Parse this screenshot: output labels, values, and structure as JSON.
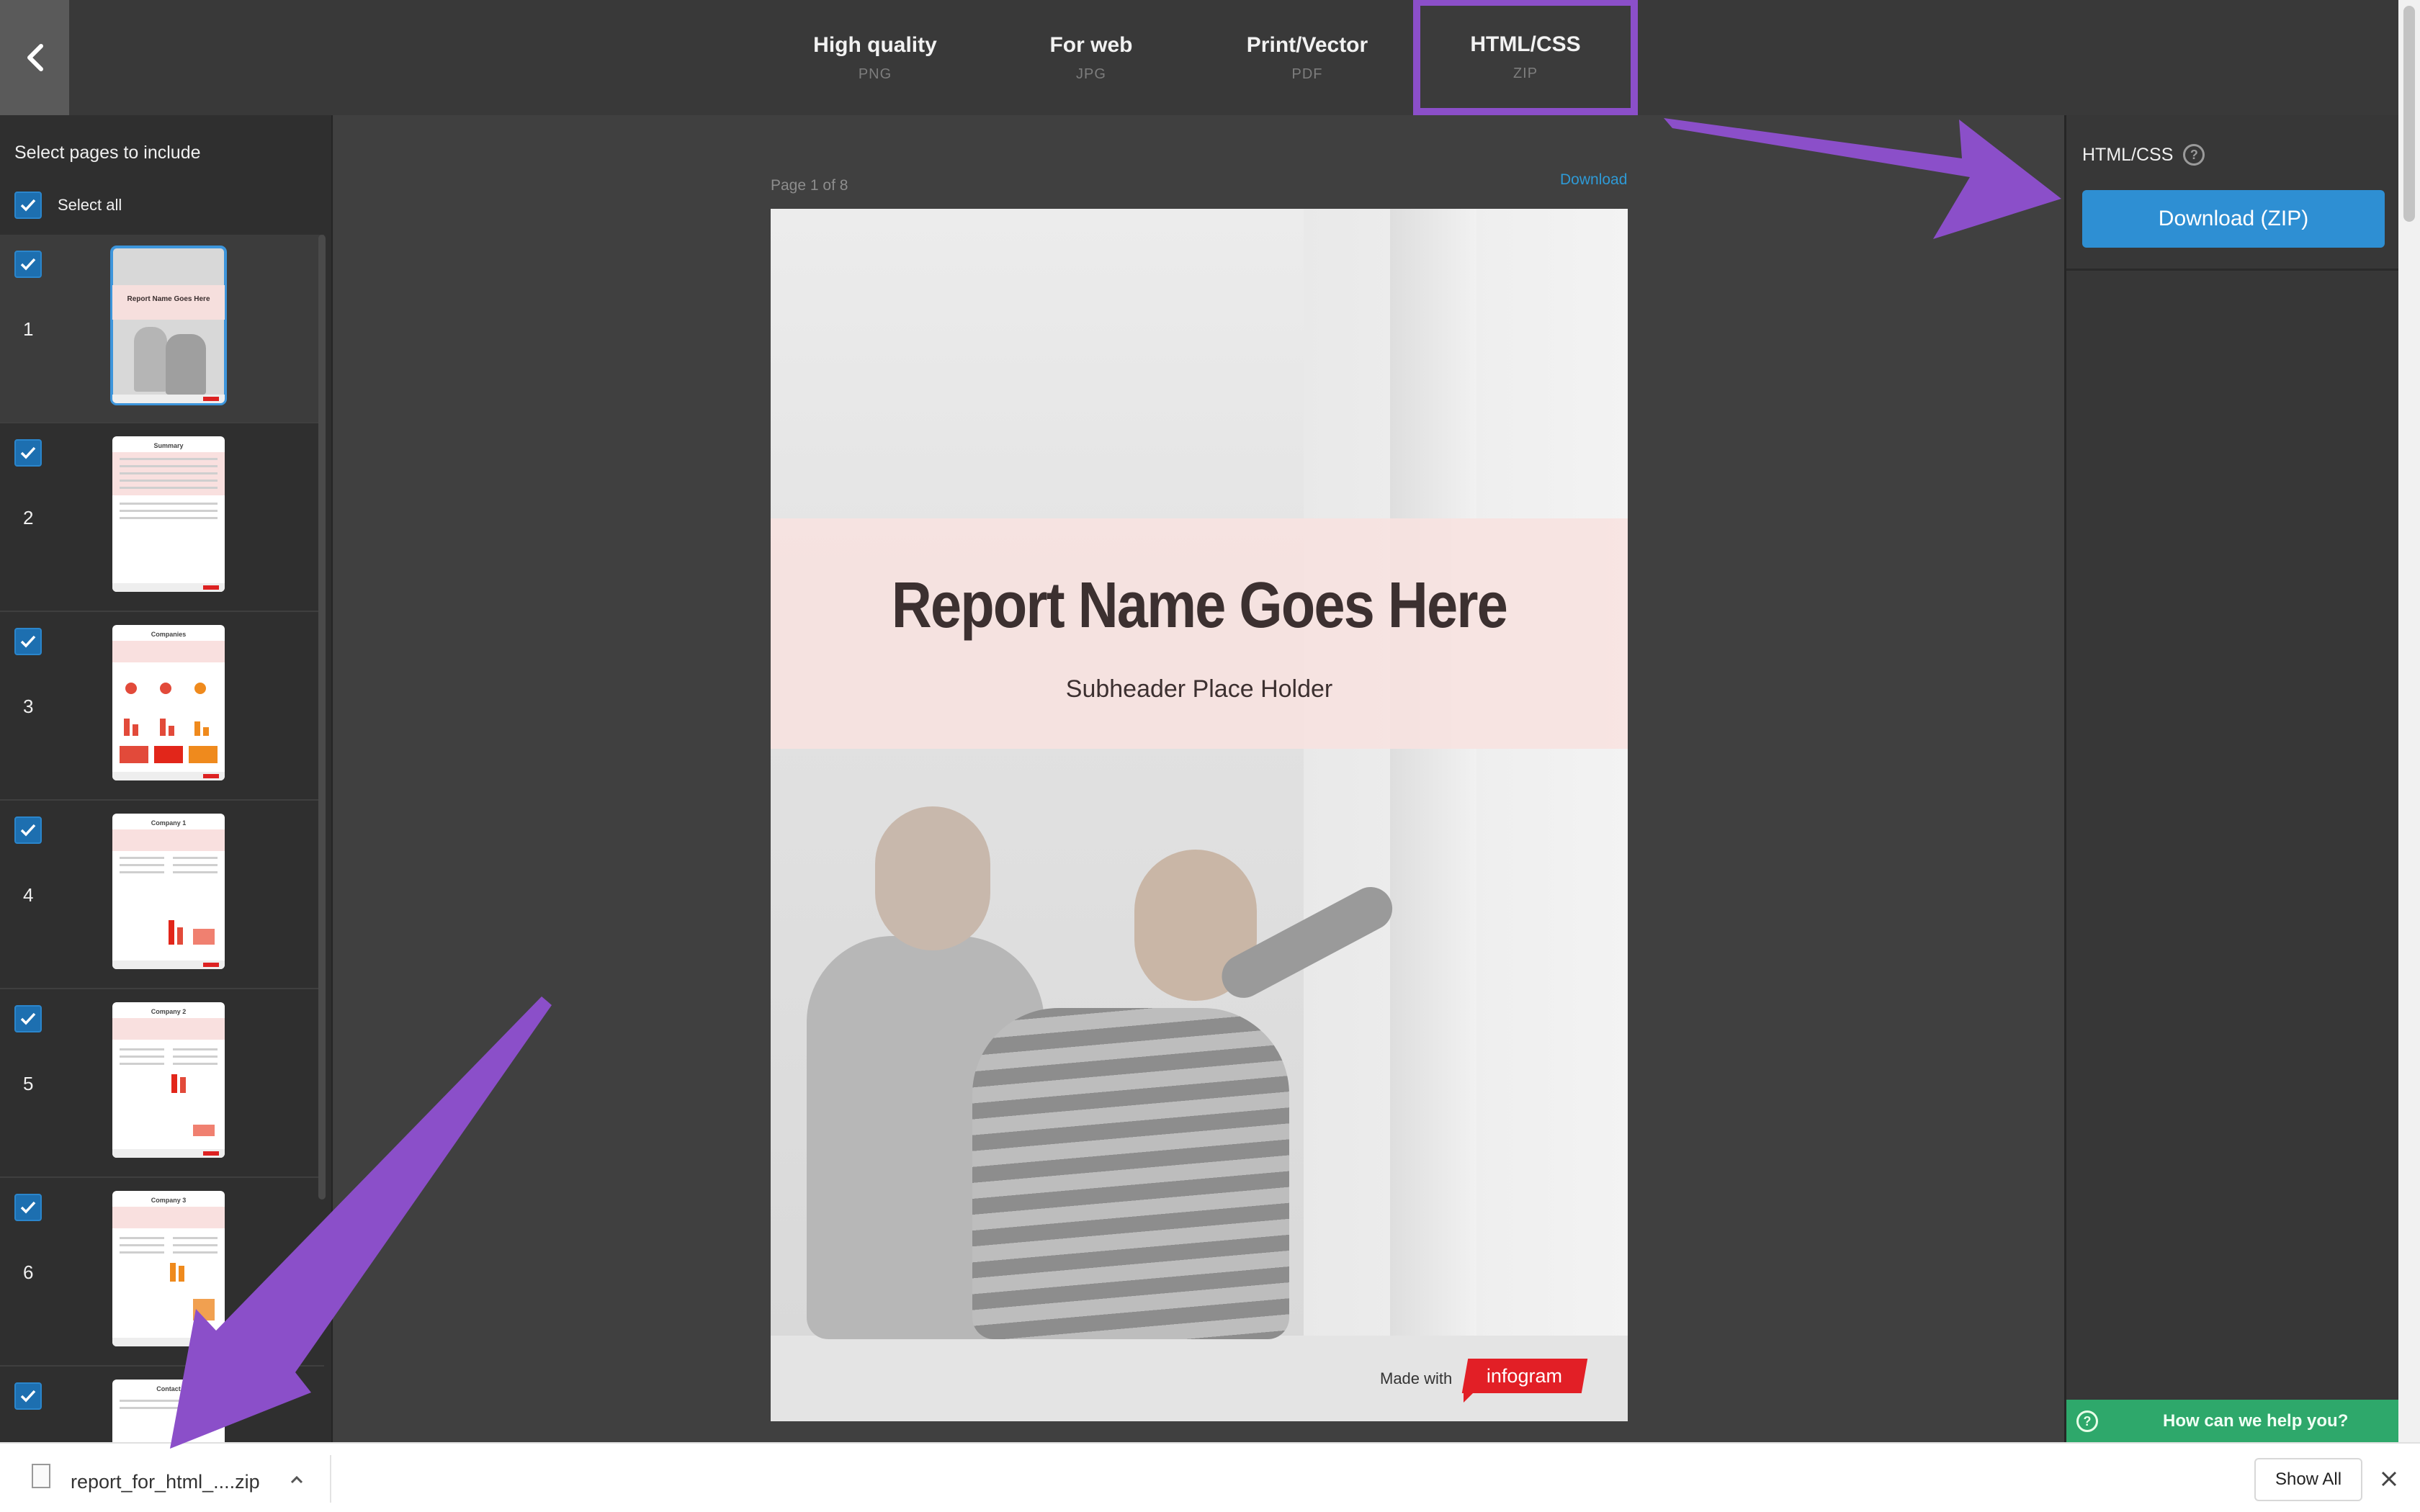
{
  "topbar": {
    "tabs": [
      {
        "label": "High quality",
        "sub": "PNG"
      },
      {
        "label": "For web",
        "sub": "JPG"
      },
      {
        "label": "Print/Vector",
        "sub": "PDF"
      },
      {
        "label": "HTML/CSS",
        "sub": "ZIP"
      }
    ],
    "active_tab": "HTML/CSS",
    "active_color": "#8b4fc9"
  },
  "sidebar": {
    "title": "Select pages to include",
    "select_all": "Select all",
    "pages": [
      {
        "num": "1",
        "thumb_title": "Report Name Goes Here",
        "checked": true,
        "selected": true
      },
      {
        "num": "2",
        "thumb_title": "Summary",
        "checked": true
      },
      {
        "num": "3",
        "thumb_title": "Companies",
        "checked": true
      },
      {
        "num": "4",
        "thumb_title": "Company 1",
        "checked": true
      },
      {
        "num": "5",
        "thumb_title": "Company 2",
        "checked": true
      },
      {
        "num": "6",
        "thumb_title": "Company 3",
        "checked": true
      },
      {
        "num": "",
        "thumb_title": "Contact",
        "checked": true
      }
    ]
  },
  "preview": {
    "page_indicator": "Page 1 of 8",
    "download_link": "Download",
    "report_title": "Report Name Goes Here",
    "report_subtitle": "Subheader Place Holder",
    "made_with": "Made with",
    "brand": "infogram",
    "brand_color": "#e21f26"
  },
  "right_panel": {
    "label": "HTML/CSS",
    "help_glyph": "?",
    "download_button": "Download (ZIP)",
    "button_color": "#2e8fd3",
    "help_bar": "How can we help you?",
    "help_bar_color": "#2ea86b"
  },
  "download_shelf": {
    "file_name": "report_for_html_....zip",
    "show_all": "Show All"
  }
}
